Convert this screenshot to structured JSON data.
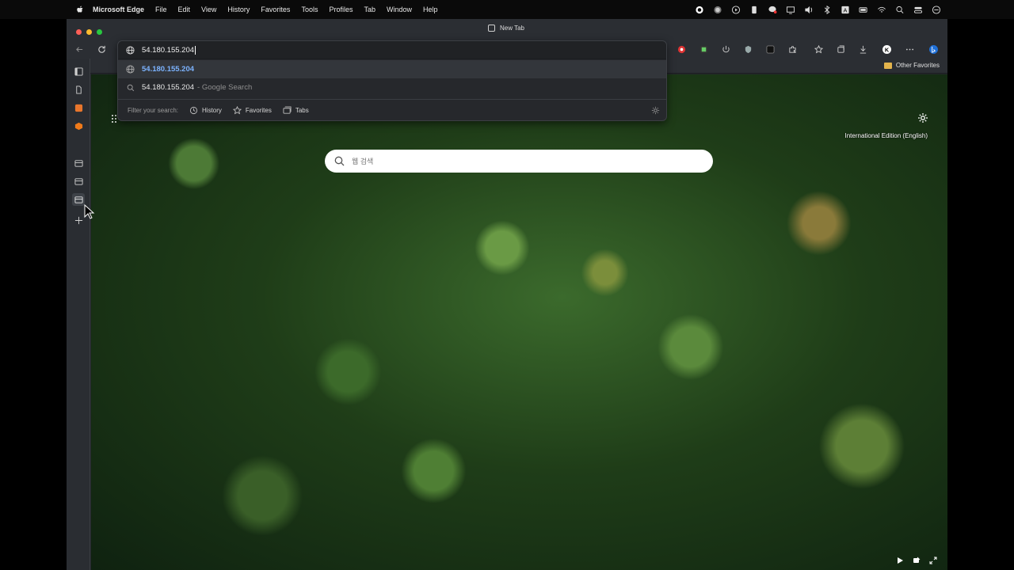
{
  "menubar": {
    "app_name": "Microsoft Edge",
    "items": [
      "File",
      "Edit",
      "View",
      "History",
      "Favorites",
      "Tools",
      "Profiles",
      "Tab",
      "Window",
      "Help"
    ]
  },
  "window": {
    "tab_title": "New Tab"
  },
  "omnibox": {
    "value": "54.180.155.204",
    "suggestions": [
      {
        "text": "54.180.155.204",
        "suffix": ""
      },
      {
        "text": "54.180.155.204",
        "suffix": "- Google Search"
      }
    ],
    "filter_label": "Filter your search:",
    "filters": [
      "History",
      "Favorites",
      "Tabs"
    ]
  },
  "favorites_bar": {
    "other_favorites": "Other Favorites"
  },
  "newtab": {
    "edition": "International Edition (English)",
    "search_placeholder": "웹 검색"
  },
  "colors": {
    "accent_link": "#7cb3ff",
    "folder": "#e3b44c",
    "traffic_red": "#ff5f57",
    "traffic_yellow": "#febc2e",
    "traffic_green": "#28c840"
  }
}
